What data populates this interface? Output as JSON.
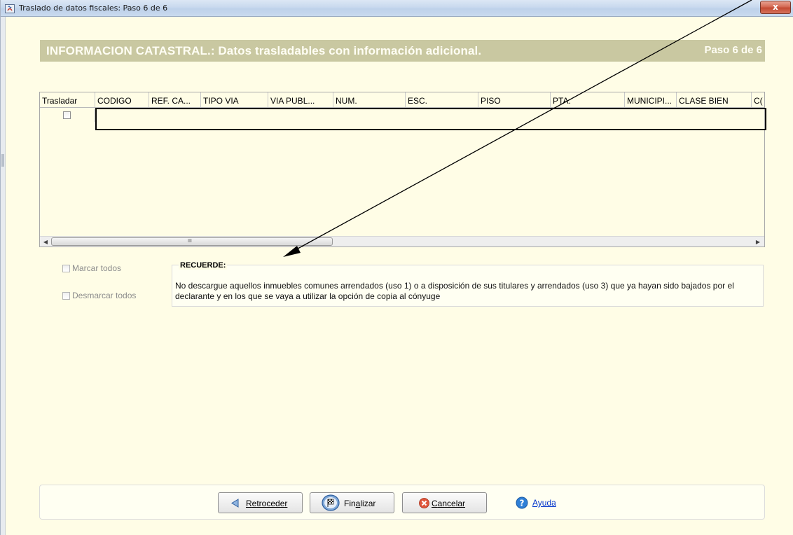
{
  "window": {
    "title": "Traslado de datos fiscales: Paso 6 de 6",
    "close_label": "x"
  },
  "header": {
    "title": "INFORMACION CATASTRAL.: Datos trasladables con información adicional.",
    "step": "Paso  6 de 6"
  },
  "table": {
    "columns": [
      "Trasladar",
      "CODIGO",
      "REF. CA...",
      "TIPO VIA",
      "VIA PUBL...",
      "NUM.",
      "ESC.",
      "PISO",
      "PTA.",
      "MUNICIPI...",
      "CLASE BIEN",
      "C("
    ],
    "rows": [
      {
        "trasladar": false
      }
    ],
    "scroll_grip": "III"
  },
  "options": {
    "marcar_todos": "Marcar todos",
    "desmarcar_todos": "Desmarcar todos"
  },
  "recuerde": {
    "title": "RECUERDE:",
    "text": "No descargue aquellos inmuebles comunes arrendados (uso 1) o a disposición de sus titulares y arrendados (uso 3) que ya hayan sido bajados por el declarante y en los que se vaya a utilizar la opción de copia al cónyuge"
  },
  "buttons": {
    "retroceder": {
      "mnemonic": "R",
      "rest": "etroceder"
    },
    "finalizar": {
      "pre": "Fin",
      "mnemonic": "a",
      "rest": "lizar"
    },
    "cancelar": {
      "mnemonic": "C",
      "rest": "ancelar"
    },
    "ayuda": "Ayuda"
  },
  "colors": {
    "background": "#fffde6",
    "header_bar": "#c9c8a1",
    "link": "#0033cc",
    "annotation": "#000000"
  },
  "icons": {
    "app": "java-app-icon",
    "retroceder": "back-arrow-icon",
    "finalizar": "finish-flag-icon",
    "cancelar": "cancel-icon",
    "ayuda": "help-icon"
  }
}
